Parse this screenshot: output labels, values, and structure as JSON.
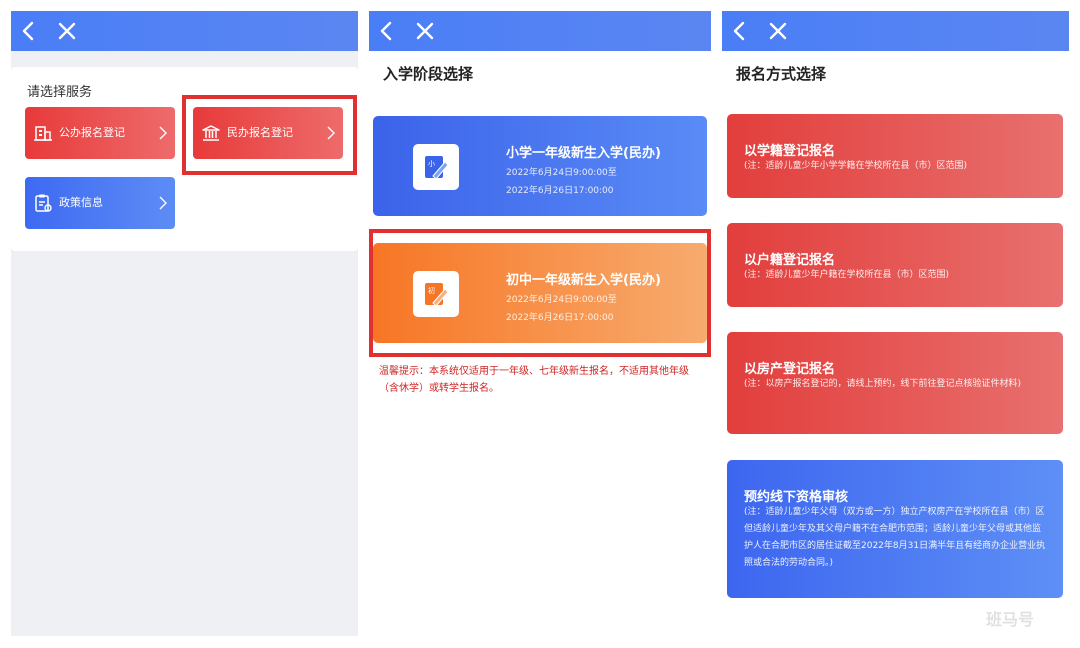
{
  "colors": {
    "topbar": "#4a7ef6",
    "red_accent": "#e83a3a",
    "blue_accent": "#3d6af2",
    "orange_accent": "#f77625",
    "highlight_frame": "#e03030",
    "notice_text": "#d02525"
  },
  "icons": {
    "back": "chevron-left-icon",
    "close": "close-icon",
    "public_registration": "building-icon",
    "private_registration": "bank-icon",
    "policy_info": "clipboard-icon",
    "arrow": "chevron-right-icon",
    "primary_stage": "pencil-book-icon",
    "junior_stage": "pencil-book-icon"
  },
  "panel1": {
    "title": "请选择服务",
    "services": [
      {
        "label": "公办报名登记"
      },
      {
        "label": "民办报名登记"
      },
      {
        "label": "政策信息"
      }
    ]
  },
  "panel2": {
    "heading": "入学阶段选择",
    "stages": [
      {
        "title": "小学一年级新生入学(民办)",
        "start": "2022年6月24日9:00:00至",
        "end": "2022年6月26日17:00:00",
        "icon_glyph": "小"
      },
      {
        "title": "初中一年级新生入学(民办)",
        "start": "2022年6月24日9:00:00至",
        "end": "2022年6月26日17:00:00",
        "icon_glyph": "初"
      }
    ],
    "notice": "温馨提示：本系统仅适用于一年级、七年级新生报名，不适用其他年级（含休学）或转学生报名。"
  },
  "panel3": {
    "heading": "报名方式选择",
    "methods": [
      {
        "title": "以学籍登记报名",
        "note": "(注：适龄儿童少年小学学籍在学校所在县（市）区范围)"
      },
      {
        "title": "以户籍登记报名",
        "note": "(注：适龄儿童少年户籍在学校所在县（市）区范围)"
      },
      {
        "title": "以房产登记报名",
        "note": "(注：以房产报名登记的，请线上预约，线下前往登记点核验证件材料)"
      },
      {
        "title": "预约线下资格审核",
        "note": "(注：适龄儿童少年父母（双方或一方）独立产权房产在学校所在县（市）区但适龄儿童少年及其父母户籍不在合肥市范围；适龄儿童少年父母或其他监护人在合肥市区的居住证截至2022年8月31日满半年且有经商办企业营业执照或合法的劳动合同。)"
      }
    ]
  },
  "watermark": "班马号"
}
